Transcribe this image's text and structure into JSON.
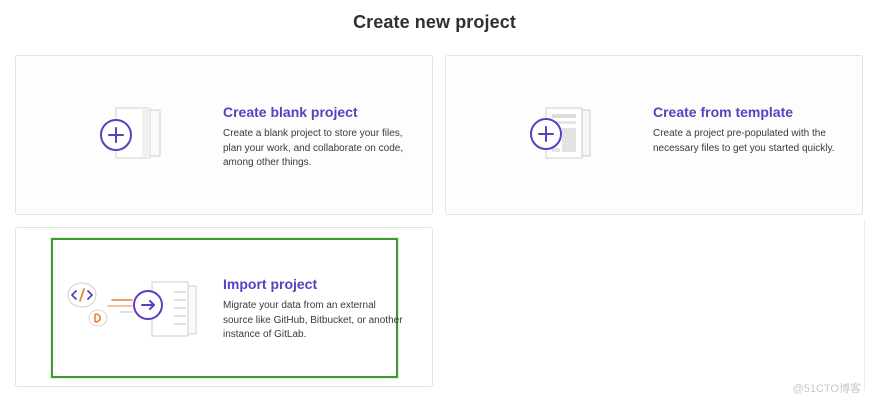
{
  "page": {
    "title": "Create new project"
  },
  "cards": {
    "blank": {
      "title": "Create blank project",
      "description": "Create a blank project to store your files, plan your work, and collaborate on code, among other things.",
      "icon": "plus-icon"
    },
    "template": {
      "title": "Create from template",
      "description": "Create a project pre-populated with the necessary files to get you started quickly.",
      "icon": "plus-icon"
    },
    "import": {
      "title": "Import project",
      "description": "Migrate your data from an external source like GitHub, Bitbucket, or another instance of GitLab.",
      "icon": "arrow-right-icon",
      "highlighted": true
    }
  },
  "colors": {
    "accent": "#5a3fbf",
    "highlight_border": "#3c9a2e",
    "import_orange": "#e8833a",
    "card_border": "#e2e2e2"
  },
  "watermark": {
    "text": "@51CTO博客"
  }
}
